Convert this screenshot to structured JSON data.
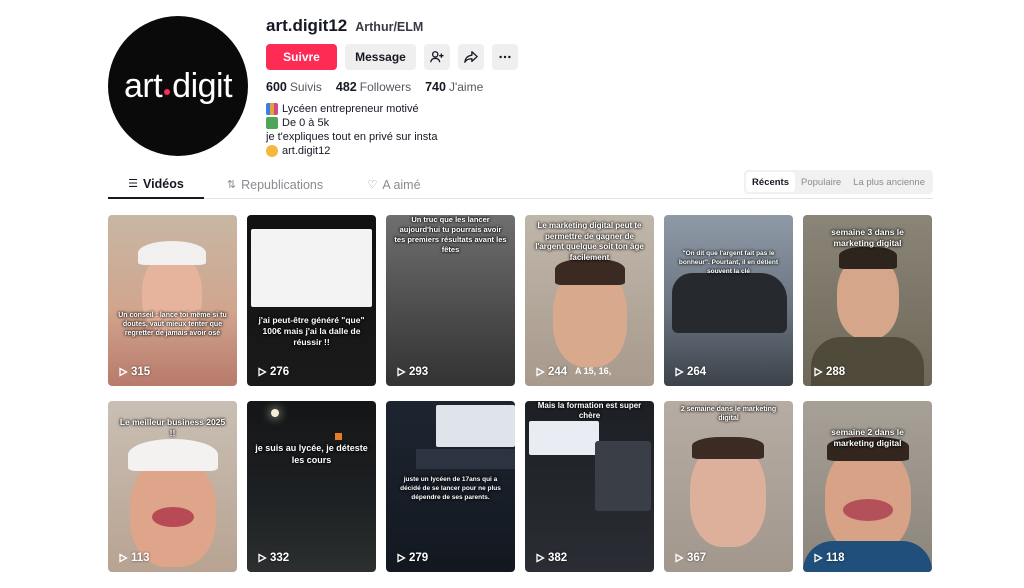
{
  "profile": {
    "avatar_text_left": "art",
    "avatar_text_right": "digit",
    "username": "art.digit12",
    "nickname": "Arthur/ELM",
    "follow_label": "Suivre",
    "message_label": "Message",
    "following_count": "600",
    "following_label": "Suivis",
    "followers_count": "482",
    "followers_label": "Followers",
    "likes_count": "740",
    "likes_label": "J'aime",
    "bio": [
      {
        "icon": "books-emoji-icon",
        "text": "Lycéen entrepreneur motivé"
      },
      {
        "icon": "money-emoji-icon",
        "text": "De 0 à 5k"
      },
      {
        "icon": "",
        "text": "je t'expliques tout en privé sur insta"
      },
      {
        "icon": "pointing-hand-emoji-icon",
        "text": "art.digit12"
      }
    ]
  },
  "tabs": {
    "videos": "Vidéos",
    "reposts": "Republications",
    "liked": "A aimé"
  },
  "sort": {
    "recent": "Récents",
    "popular": "Populaire",
    "oldest": "La plus ancienne"
  },
  "videos": [
    {
      "caption": "Un conseil : lance toi même si tu doutes, vaut mieux tenter que regretter de jamais avoir osé",
      "views": "315",
      "extra": ""
    },
    {
      "caption": "j'ai peut-être généré \"que\" 100€ mais j'ai la dalle de réussir !!",
      "views": "276",
      "extra": ""
    },
    {
      "caption": "Un truc que les lancer aujourd'hui tu pourrais avoir tes premiers résultats avant les fêtes",
      "views": "293",
      "extra": ""
    },
    {
      "caption": "Le marketing digital peut te permettre de gagner de l'argent quelque soit ton âge facilement",
      "views": "244",
      "extra": "A 15, 16,"
    },
    {
      "caption": "\"On dit que l'argent fait pas le bonheur\". Pourtant, il en détient souvent la clé",
      "views": "264",
      "extra": ""
    },
    {
      "caption": "semaine 3 dans le marketing digital",
      "views": "288",
      "extra": ""
    },
    {
      "caption": "Le meilleur business 2025 !!",
      "views": "113",
      "extra": ""
    },
    {
      "caption": "je suis au lycée, je déteste les cours",
      "views": "332",
      "extra": ""
    },
    {
      "caption": "juste un lycéen de 17ans qui a décidé de se lancer pour ne plus dépendre de ses parents.",
      "views": "279",
      "extra": ""
    },
    {
      "caption": "Mais la formation est super chère",
      "views": "382",
      "extra": ""
    },
    {
      "caption": "2 semaine dans le marketing digital",
      "views": "367",
      "extra": ""
    },
    {
      "caption": "semaine 2 dans le marketing digital",
      "views": "118",
      "extra": ""
    }
  ],
  "colors": {
    "brand_red": "#fe2c55",
    "text_primary": "#161823",
    "text_secondary": "#8a8b91"
  }
}
